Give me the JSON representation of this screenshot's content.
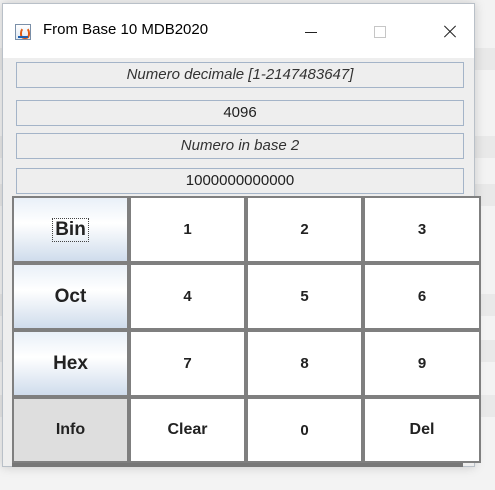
{
  "window": {
    "title": "From Base 10 MDB2020",
    "minimize_label": "",
    "maximize_label": "",
    "close_label": ""
  },
  "fields": {
    "decimal_label": "Numero decimale [1-2147483647]",
    "decimal_value": "4096",
    "result_label": "Numero in base 2",
    "result_value": "1000000000000"
  },
  "keypad": {
    "bin": "Bin",
    "oct": "Oct",
    "hex": "Hex",
    "info": "Info",
    "k1": "1",
    "k2": "2",
    "k3": "3",
    "k4": "4",
    "k5": "5",
    "k6": "6",
    "k7": "7",
    "k8": "8",
    "k9": "9",
    "clear": "Clear",
    "k0": "0",
    "del": "Del"
  },
  "icons": {
    "app": "java-cup-icon",
    "minimize": "minimize-icon",
    "maximize": "maximize-icon",
    "close": "close-icon"
  }
}
